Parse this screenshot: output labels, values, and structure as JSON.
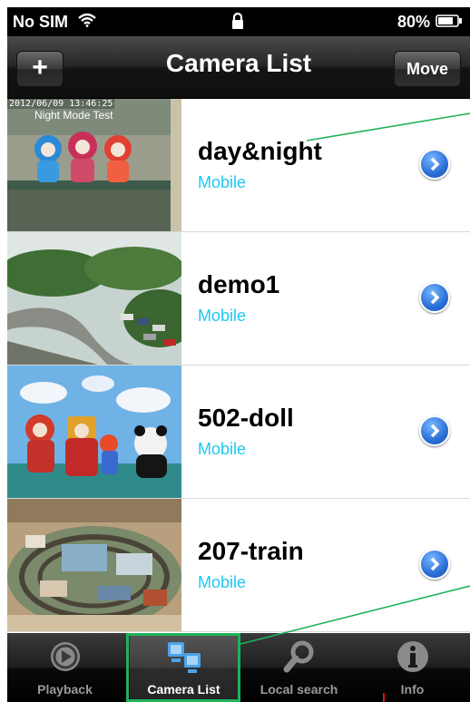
{
  "status": {
    "carrier": "No SIM",
    "battery": "80%",
    "battery_level": 0.8
  },
  "nav": {
    "add_label": "+",
    "title": "Camera List",
    "move_label": "Move"
  },
  "cameras": [
    {
      "name": "day&night",
      "type": "Mobile",
      "timestamp": "2012/06/09 13:46:25",
      "caption": "Night Mode Test"
    },
    {
      "name": "demo1",
      "type": "Mobile"
    },
    {
      "name": "502-doll",
      "type": "Mobile"
    },
    {
      "name": "207-train",
      "type": "Mobile"
    }
  ],
  "tabs": [
    {
      "label": "Playback",
      "icon": "playback-icon"
    },
    {
      "label": "Camera List",
      "icon": "camera-list-icon",
      "active": true
    },
    {
      "label": "Local search",
      "icon": "search-icon"
    },
    {
      "label": "Info",
      "icon": "info-icon"
    }
  ],
  "colors": {
    "accent": "#1ec8f0",
    "annotation": "#1db35a",
    "marker": "#e01010"
  }
}
